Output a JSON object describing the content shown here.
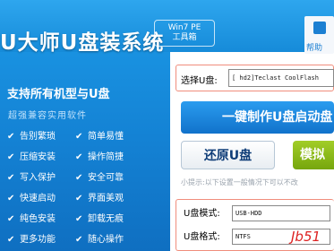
{
  "header": {
    "brand": "U大师U盘装系统",
    "badge_line1": "Win7 PE",
    "badge_line2": "工具箱",
    "help_label": "帮助"
  },
  "left_panel": {
    "title": "支持所有机型与U盘",
    "subtitle": "超强兼容实用软件",
    "features": [
      {
        "a": "告别繁琐",
        "b": "简单易懂"
      },
      {
        "a": "压缩安装",
        "b": "操作简捷"
      },
      {
        "a": "写入保护",
        "b": "安全可靠"
      },
      {
        "a": "快速启动",
        "b": "界面美观"
      },
      {
        "a": "纯色安装",
        "b": "卸载无痕"
      },
      {
        "a": "更多功能",
        "b": "随心操作"
      }
    ]
  },
  "main": {
    "select_label": "选择U盘:",
    "select_value": "[ hd2]Teclast CoolFlash",
    "oneclick_button": "一键制作U盘启动盘",
    "restore_button": "还原U盘",
    "simulate_button": "模拟",
    "hint": "小提示:以下设置一般情况下可以不改",
    "mode_label": "U盘模式:",
    "mode_value": "USB-HDD",
    "format_label": "U盘格式:",
    "format_value": "NTFS",
    "watermark": "Jb51"
  }
}
